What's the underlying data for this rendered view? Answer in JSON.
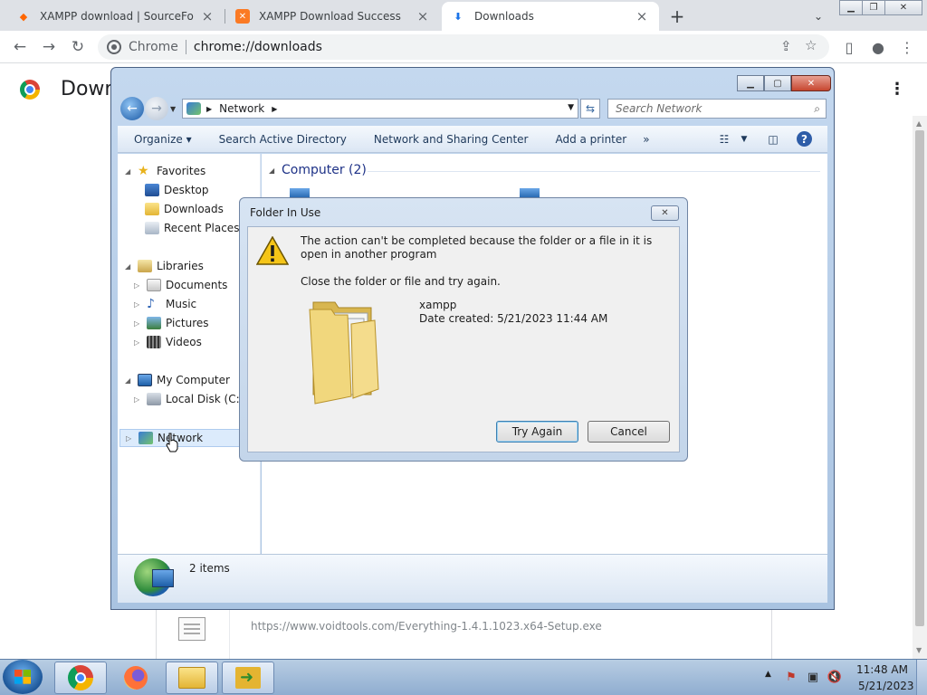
{
  "browser": {
    "tabs": [
      {
        "title": "XAMPP download | SourceForge",
        "favicon": "sourceforge-icon",
        "active": false
      },
      {
        "title": "XAMPP Download Success",
        "favicon": "xampp-icon",
        "active": false
      },
      {
        "title": "Downloads",
        "favicon": "download-icon",
        "active": true
      }
    ],
    "omnibox": {
      "chip": "Chrome",
      "url": "chrome://downloads"
    }
  },
  "downloads_page": {
    "title": "Down",
    "item_url": "https://www.voidtools.com/Everything-1.4.1.1023.x64-Setup.exe"
  },
  "explorer": {
    "breadcrumb": "Network",
    "search_placeholder": "Search Network",
    "commands": [
      "Organize",
      "Search Active Directory",
      "Network and Sharing Center",
      "Add a printer"
    ],
    "more": "»",
    "nav_tree": {
      "favorites": {
        "label": "Favorites",
        "items": [
          "Desktop",
          "Downloads",
          "Recent Places"
        ]
      },
      "libraries": {
        "label": "Libraries",
        "items": [
          "Documents",
          "Music",
          "Pictures",
          "Videos"
        ]
      },
      "computer": {
        "label": "My Computer",
        "items": [
          "Local Disk (C:)"
        ]
      },
      "network": {
        "label": "Network"
      }
    },
    "group_title": "Computer (2)",
    "status": "2 items"
  },
  "dialog": {
    "title": "Folder In Use",
    "message": "The action can't be completed because the folder or a file in it is open in another program",
    "instruction": "Close the folder or file and try again.",
    "file_name": "xampp",
    "file_date": "Date created: 5/21/2023 11:44 AM",
    "try_again": "Try Again",
    "cancel": "Cancel"
  },
  "taskbar": {
    "time": "11:48 AM",
    "date": "5/21/2023"
  }
}
